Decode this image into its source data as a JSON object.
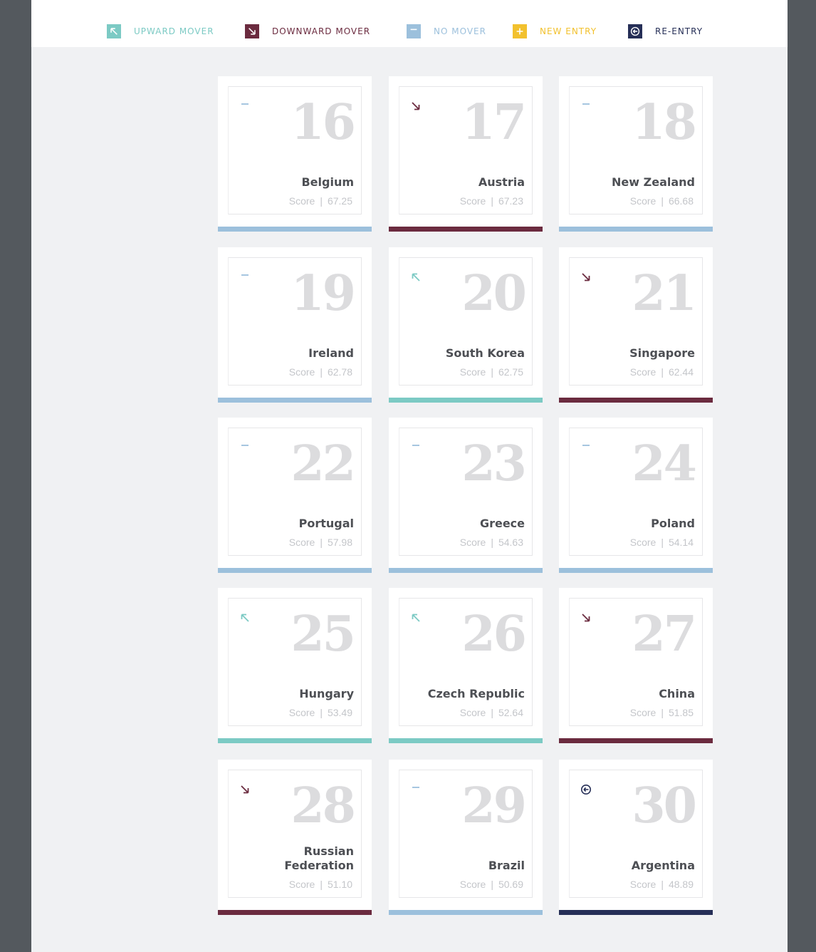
{
  "legend": [
    {
      "label": "UPWARD MOVER",
      "icon": "upward-mover-icon",
      "color": "#7ccac4",
      "type": "up"
    },
    {
      "label": "DOWNWARD MOVER",
      "icon": "downward-mover-icon",
      "color": "#6b2b3f",
      "type": "down"
    },
    {
      "label": "NO MOVER",
      "icon": "no-mover-icon",
      "color": "#9cc0dc",
      "type": "none"
    },
    {
      "label": "NEW ENTRY",
      "icon": "new-entry-icon",
      "color": "#f2c12e",
      "type": "new"
    },
    {
      "label": "RE-ENTRY",
      "icon": "re-entry-icon",
      "color": "#262f57",
      "type": "reentry"
    }
  ],
  "score_label": "Score",
  "score_separator": "|",
  "cards": [
    {
      "rank": "16",
      "country": "Belgium",
      "score": "67.25",
      "type": "none"
    },
    {
      "rank": "17",
      "country": "Austria",
      "score": "67.23",
      "type": "down"
    },
    {
      "rank": "18",
      "country": "New Zealand",
      "score": "66.68",
      "type": "none"
    },
    {
      "rank": "19",
      "country": "Ireland",
      "score": "62.78",
      "type": "none"
    },
    {
      "rank": "20",
      "country": "South Korea",
      "score": "62.75",
      "type": "up"
    },
    {
      "rank": "21",
      "country": "Singapore",
      "score": "62.44",
      "type": "down"
    },
    {
      "rank": "22",
      "country": "Portugal",
      "score": "57.98",
      "type": "none"
    },
    {
      "rank": "23",
      "country": "Greece",
      "score": "54.63",
      "type": "none"
    },
    {
      "rank": "24",
      "country": "Poland",
      "score": "54.14",
      "type": "none"
    },
    {
      "rank": "25",
      "country": "Hungary",
      "score": "53.49",
      "type": "up"
    },
    {
      "rank": "26",
      "country": "Czech Republic",
      "score": "52.64",
      "type": "up"
    },
    {
      "rank": "27",
      "country": "China",
      "score": "51.85",
      "type": "down"
    },
    {
      "rank": "28",
      "country": "Russian Federation",
      "score": "51.10",
      "type": "down"
    },
    {
      "rank": "29",
      "country": "Brazil",
      "score": "50.69",
      "type": "none"
    },
    {
      "rank": "30",
      "country": "Argentina",
      "score": "48.89",
      "type": "reentry"
    }
  ]
}
